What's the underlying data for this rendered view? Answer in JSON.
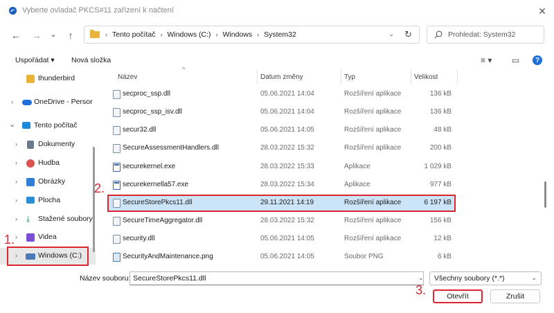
{
  "window": {
    "title": "Vyberte ovladač PKCS#11 zařízení k načtení",
    "close_symbol": "✕"
  },
  "nav": {
    "back": "←",
    "forward": "→",
    "recent": "⌄",
    "up": "↑",
    "breadcrumb": [
      "Tento počítač",
      "Windows (C:)",
      "Windows",
      "System32"
    ],
    "separator": "›",
    "refresh": "↻",
    "search_placeholder": "Prohledat: System32"
  },
  "toolbar": {
    "organize_label": "Uspořádat ▾",
    "new_folder_label": "Nová složka",
    "view_menu": "≡ ▾",
    "preview_pane": "▭",
    "help": "?"
  },
  "sidebar": {
    "items": [
      {
        "label": "thunderbird",
        "icon": "folder-icon",
        "color": "#e8b43a",
        "chevron": ""
      },
      {
        "label": "OneDrive - Persor",
        "icon": "cloud-icon",
        "color": "#1e6fd9",
        "chevron": "›"
      },
      {
        "label": "Tento počítač",
        "icon": "computer-icon",
        "color": "#1e8ad9",
        "chevron": "⌄"
      },
      {
        "label": "Dokumenty",
        "icon": "documents-icon",
        "color": "#6b7a8c",
        "chevron": "›"
      },
      {
        "label": "Hudba",
        "icon": "music-icon",
        "color": "#d9544f",
        "chevron": "›"
      },
      {
        "label": "Obrázky",
        "icon": "pictures-icon",
        "color": "#2f7fd6",
        "chevron": "›"
      },
      {
        "label": "Plocha",
        "icon": "desktop-icon",
        "color": "#2a8fd6",
        "chevron": "›"
      },
      {
        "label": "Stažené soubory",
        "icon": "downloads-icon",
        "color": "#2e8b57",
        "chevron": "›"
      },
      {
        "label": "Videa",
        "icon": "videos-icon",
        "color": "#7a4fd6",
        "chevron": "›"
      },
      {
        "label": "Windows  (C:)",
        "icon": "drive-icon",
        "color": "#4a7ab8",
        "chevron": "›"
      }
    ]
  },
  "filelist": {
    "columns": {
      "name": "Název",
      "date": "Datum změny",
      "type": "Typ",
      "size": "Velikost"
    },
    "sort_indicator": "^",
    "rows": [
      {
        "name": "secproc_ssp.dll",
        "date": "05.06.2021 14:04",
        "type": "Rozšíření aplikace",
        "size": "136 kB",
        "kind": "dll"
      },
      {
        "name": "secproc_ssp_isv.dll",
        "date": "05.06.2021 14:04",
        "type": "Rozšíření aplikace",
        "size": "136 kB",
        "kind": "dll"
      },
      {
        "name": "secur32.dll",
        "date": "05.06.2021 14:05",
        "type": "Rozšíření aplikace",
        "size": "48 kB",
        "kind": "dll"
      },
      {
        "name": "SecureAssessmentHandlers.dll",
        "date": "28.03.2022 15:32",
        "type": "Rozšíření aplikace",
        "size": "200 kB",
        "kind": "dll"
      },
      {
        "name": "securekernel.exe",
        "date": "28.03.2022 15:33",
        "type": "Aplikace",
        "size": "1 029 kB",
        "kind": "exe"
      },
      {
        "name": "securekernella57.exe",
        "date": "28.03.2022 15:34",
        "type": "Aplikace",
        "size": "977 kB",
        "kind": "exe"
      },
      {
        "name": "SecureStorePkcs11.dll",
        "date": "29.11.2021 14:19",
        "type": "Rozšíření aplikace",
        "size": "6 197 kB",
        "kind": "dll",
        "selected": true
      },
      {
        "name": "SecureTimeAggregator.dll",
        "date": "28.03.2022 15:32",
        "type": "Rozšíření aplikace",
        "size": "156 kB",
        "kind": "dll"
      },
      {
        "name": "security.dll",
        "date": "05.06.2021 14:05",
        "type": "Rozšíření aplikace",
        "size": "12 kB",
        "kind": "dll"
      },
      {
        "name": "SecurityAndMaintenance.png",
        "date": "05.06.2021 14:05",
        "type": "Soubor PNG",
        "size": "6 kB",
        "kind": "png"
      }
    ]
  },
  "footer": {
    "filename_label": "Název souboru:",
    "filename_value": "SecureStorePkcs11.dll",
    "filetype_value": "Všechny soubory (*.*)",
    "dropdown_symbol": "⌄",
    "open_label": "Otevřít",
    "cancel_label": "Zrušit"
  },
  "annotations": {
    "step1": "1.",
    "step2": "2.",
    "step3": "3.",
    "color": "#d9262f"
  }
}
